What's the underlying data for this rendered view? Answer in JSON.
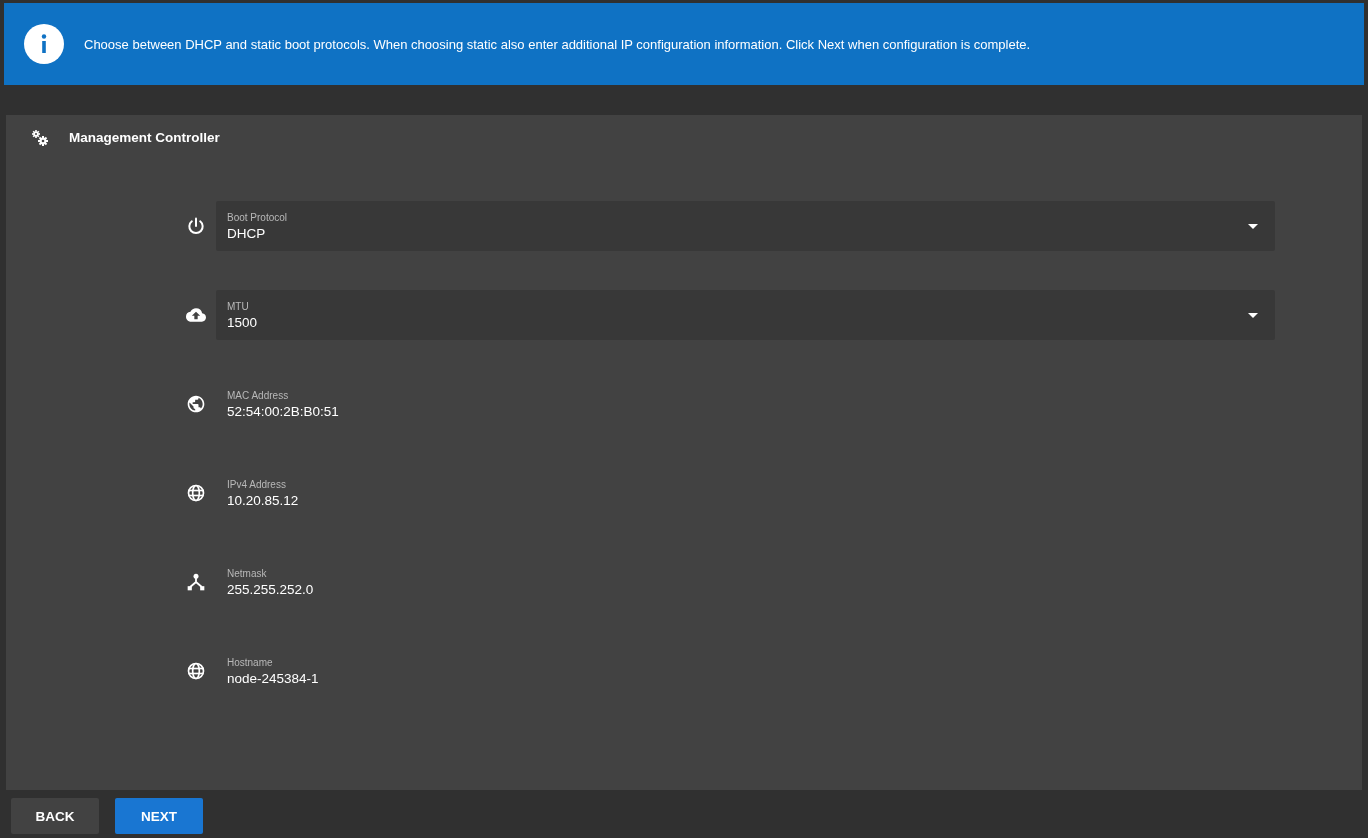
{
  "banner": {
    "text": "Choose between DHCP and static boot protocols. When choosing static also enter additional IP configuration information. Click Next when configuration is complete."
  },
  "card": {
    "title": "Management Controller"
  },
  "fields": [
    {
      "kind": "select",
      "label": "Boot Protocol",
      "value": "DHCP"
    },
    {
      "kind": "select",
      "label": "MTU",
      "value": "1500"
    },
    {
      "kind": "readonly",
      "label": "MAC Address",
      "value": "52:54:00:2B:B0:51"
    },
    {
      "kind": "readonly",
      "label": "IPv4 Address",
      "value": "10.20.85.12"
    },
    {
      "kind": "readonly",
      "label": "Netmask",
      "value": "255.255.252.0"
    },
    {
      "kind": "readonly",
      "label": "Hostname",
      "value": "node-245384-1"
    }
  ],
  "buttons": [
    {
      "kind": "secondary",
      "label": "BACK"
    },
    {
      "kind": "primary",
      "label": "NEXT"
    }
  ]
}
